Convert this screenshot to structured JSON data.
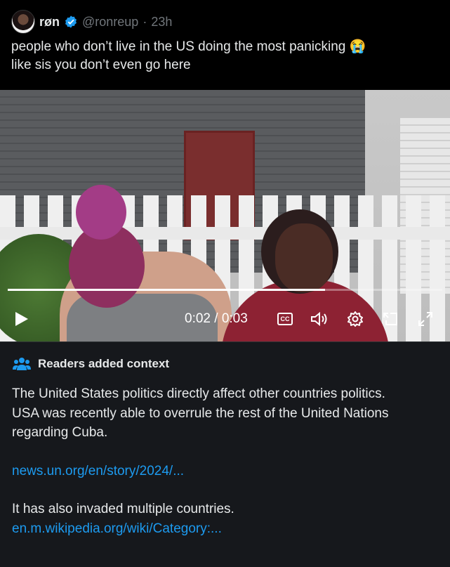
{
  "tweet": {
    "author_name": "røn",
    "handle": "@ronreup",
    "separator": "·",
    "time": "23h",
    "text_line1": "people who don’t live in the US doing the most panicking 😭",
    "text_line2": "like sis you don’t even go here"
  },
  "video": {
    "progress_fraction": 0.73,
    "time_display": "0:02 / 0:03",
    "cc_label": "CC",
    "icons": [
      "play-icon",
      "closed-captions-icon",
      "volume-icon",
      "settings-icon",
      "pop-out-icon",
      "fullscreen-icon"
    ]
  },
  "context": {
    "title": "Readers added context",
    "paragraph1": "The United States politics directly affect other countries politics.",
    "paragraph2": "USA was recently able to overrule the rest of the United Nations regarding Cuba.",
    "link1": "news.un.org/en/story/2024/...",
    "paragraph3": "It has also invaded multiple countries.",
    "link2": "en.m.wikipedia.org/wiki/Category:..."
  },
  "colors": {
    "background": "#000000",
    "card": "#16181c",
    "link": "#1d9bf0",
    "verified": "#1d9bf0",
    "muted": "#71767b"
  }
}
